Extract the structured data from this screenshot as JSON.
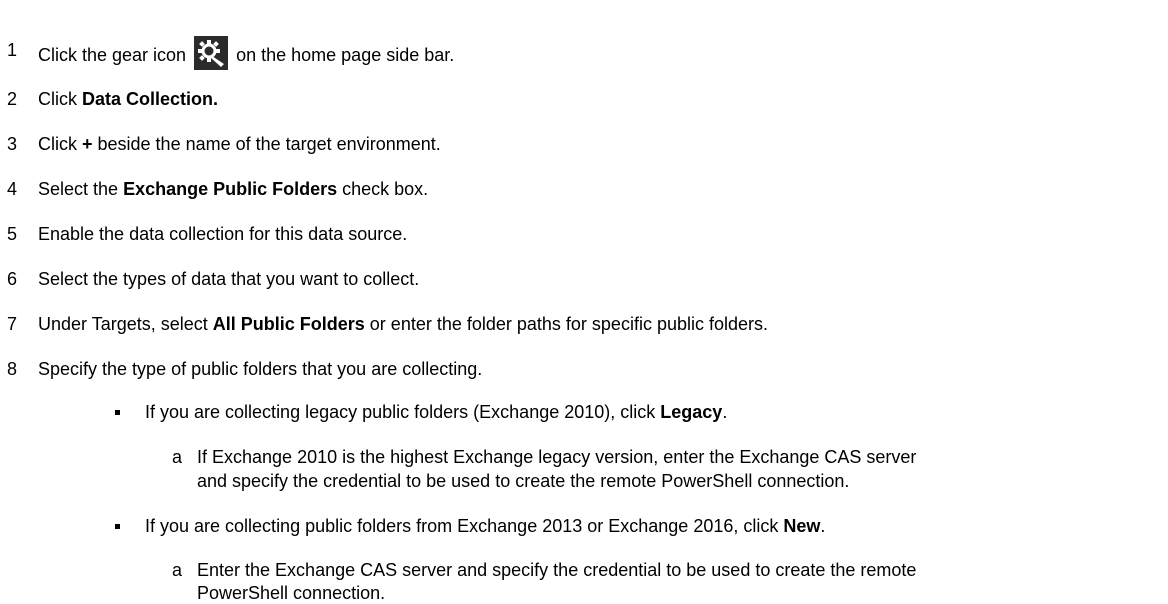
{
  "steps": [
    {
      "num": "1",
      "parts": {
        "pre": "Click the gear icon",
        "icon": "gear-icon",
        "post": " on the home page side bar."
      }
    },
    {
      "num": "2",
      "parts": {
        "pre": "Click ",
        "bold": "Data Collection."
      }
    },
    {
      "num": "3",
      "parts": {
        "pre": "Click ",
        "bold": "+",
        "post": " beside the name of the target environment."
      }
    },
    {
      "num": "4",
      "parts": {
        "pre": "Select the ",
        "bold": "Exchange Public Folders",
        "post": " check box."
      }
    },
    {
      "num": "5",
      "parts": {
        "pre": "Enable the data collection for this data source."
      }
    },
    {
      "num": "6",
      "parts": {
        "pre": "Select the types of data that you want to collect."
      }
    },
    {
      "num": "7",
      "parts": {
        "pre": "Under Targets, select ",
        "bold": "All Public Folders",
        "post": " or enter the folder paths for specific public folders."
      }
    },
    {
      "num": "8",
      "parts": {
        "pre": "Specify the type of public folders that you are collecting."
      }
    }
  ],
  "bullets": [
    {
      "pre": "If you are collecting legacy public folders (Exchange 2010), click ",
      "bold": "Legacy",
      "post": ".",
      "sub_letter": "a",
      "sub_line1": "If Exchange 2010 is the highest Exchange legacy version, enter the Exchange CAS server",
      "sub_line2": "and specify the credential to be used to create the remote PowerShell connection."
    },
    {
      "pre": "If you are collecting public folders from Exchange 2013 or Exchange 2016, click ",
      "bold": "New",
      "post": ".",
      "sub_letter": "a",
      "sub_line1": "Enter the Exchange CAS server and specify the credential to be used to create the remote",
      "sub_line2": "PowerShell connection."
    }
  ]
}
